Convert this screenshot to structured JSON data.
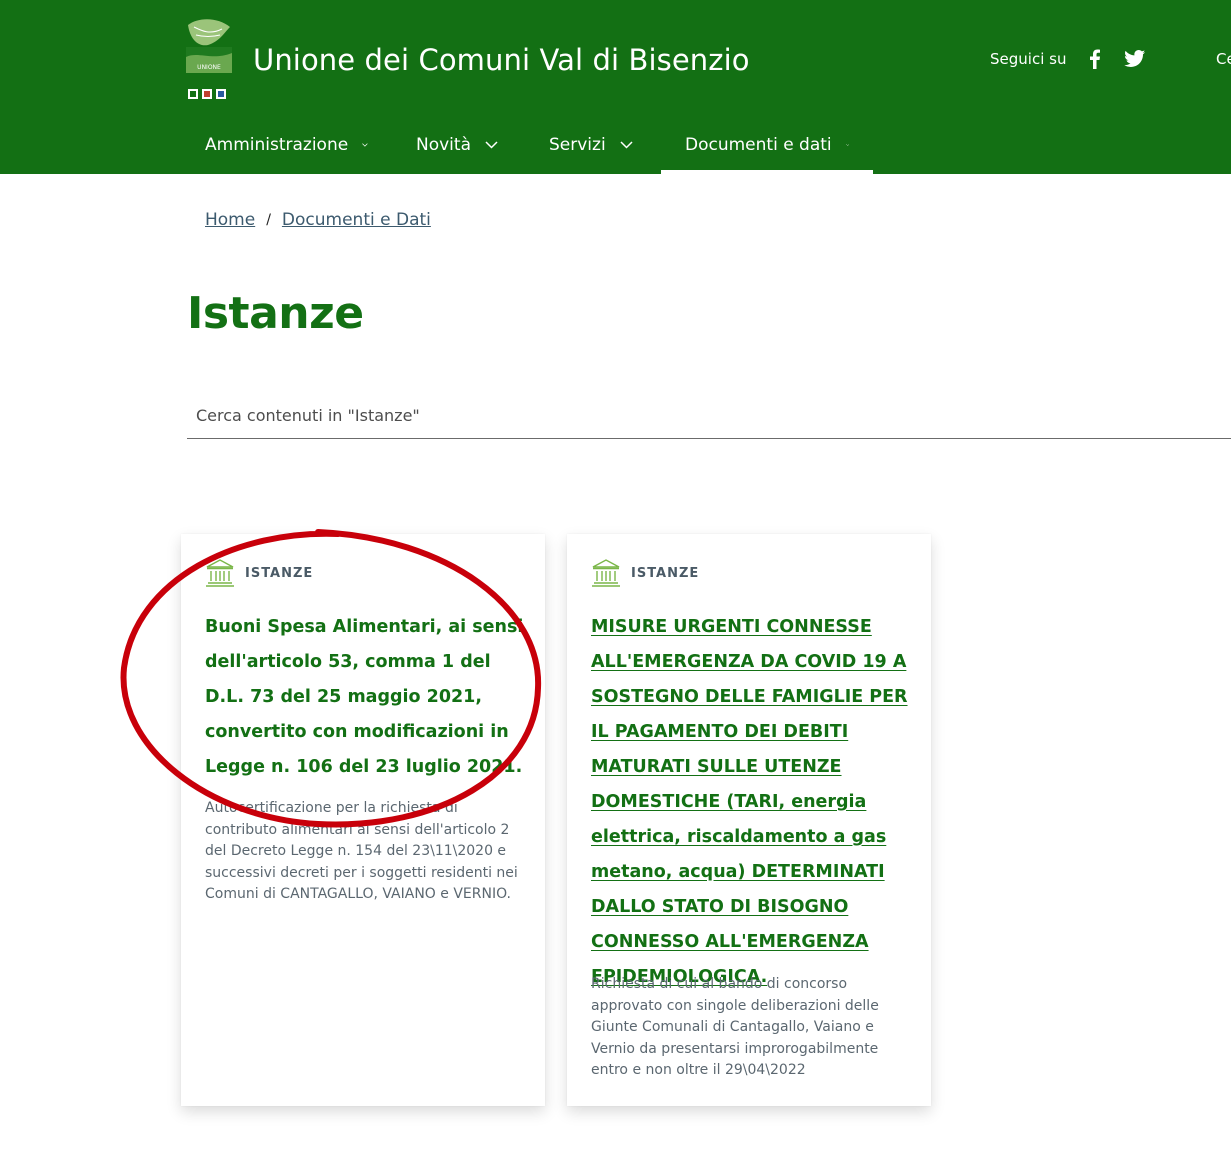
{
  "header": {
    "site_title": "Unione dei Comuni Val di Bisenzio",
    "social_label": "Seguici su",
    "cut_text": "Ce",
    "nav": [
      {
        "label": "Amministrazione"
      },
      {
        "label": "Novità"
      },
      {
        "label": "Servizi"
      },
      {
        "label": "Documenti e dati",
        "active": true
      }
    ]
  },
  "breadcrumb": {
    "home": "Home",
    "separator": "/",
    "current": "Documenti e Dati"
  },
  "page": {
    "title": "Istanze",
    "search_placeholder": "Cerca contenuti in \"Istanze\""
  },
  "cards": [
    {
      "category": "ISTANZE",
      "title": "Buoni Spesa Alimentari, ai sensi dell'articolo 53, comma 1 del D.L. 73 del 25 maggio 2021, convertito con modificazioni in Legge n. 106 del 23 luglio 2021.",
      "description": "Autocertificazione per la richiesta di contributo alimentari ai sensi dell'articolo 2 del Decreto Legge n. 154 del 23\\11\\2020 e successivi decreti per i soggetti residenti nei Comuni di CANTAGALLO, VAIANO e VERNIO."
    },
    {
      "category": "ISTANZE",
      "title": "MISURE URGENTI CONNESSE ALL'EMERGENZA DA COVID 19 A SOSTEGNO DELLE FAMIGLIE PER IL PAGAMENTO DEI DEBITI MATURATI SULLE UTENZE DOMESTICHE (TARI, energia elettrica, riscaldamento a gas metano, acqua) DETERMINATI DALLO STATO DI BISOGNO CONNESSO ALL'EMERGENZA EPIDEMIOLOGICA.",
      "description": "Richiesta di cui al bando di concorso approvato con singole deliberazioni delle Giunte Comunali di Cantagallo, Vaiano e Vernio da presentarsi improrogabilmente entro e non oltre il 29\\04\\2022"
    }
  ],
  "colors": {
    "brand_green": "#137014",
    "annotation_red": "#c8000a"
  },
  "icons": {
    "logo": "unione-logo-icon",
    "facebook": "facebook-icon",
    "twitter": "twitter-icon",
    "chevron": "chevron-down-icon",
    "category": "institution-icon"
  }
}
